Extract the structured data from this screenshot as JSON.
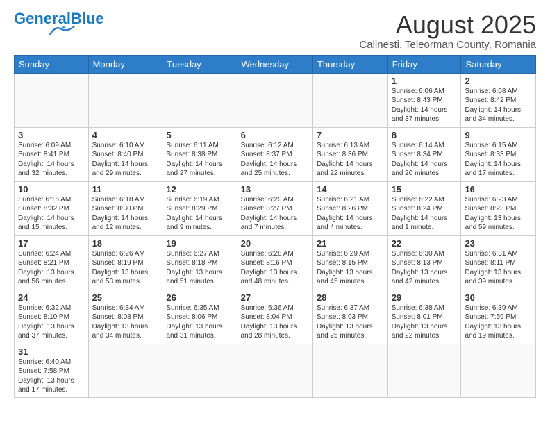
{
  "header": {
    "logo_text_general": "General",
    "logo_text_blue": "Blue",
    "title": "August 2025",
    "subtitle": "Calinesti, Teleorman County, Romania"
  },
  "weekdays": [
    "Sunday",
    "Monday",
    "Tuesday",
    "Wednesday",
    "Thursday",
    "Friday",
    "Saturday"
  ],
  "weeks": [
    [
      {
        "day": "",
        "info": ""
      },
      {
        "day": "",
        "info": ""
      },
      {
        "day": "",
        "info": ""
      },
      {
        "day": "",
        "info": ""
      },
      {
        "day": "",
        "info": ""
      },
      {
        "day": "1",
        "info": "Sunrise: 6:06 AM\nSunset: 8:43 PM\nDaylight: 14 hours and 37 minutes."
      },
      {
        "day": "2",
        "info": "Sunrise: 6:08 AM\nSunset: 8:42 PM\nDaylight: 14 hours and 34 minutes."
      }
    ],
    [
      {
        "day": "3",
        "info": "Sunrise: 6:09 AM\nSunset: 8:41 PM\nDaylight: 14 hours and 32 minutes."
      },
      {
        "day": "4",
        "info": "Sunrise: 6:10 AM\nSunset: 8:40 PM\nDaylight: 14 hours and 29 minutes."
      },
      {
        "day": "5",
        "info": "Sunrise: 6:11 AM\nSunset: 8:38 PM\nDaylight: 14 hours and 27 minutes."
      },
      {
        "day": "6",
        "info": "Sunrise: 6:12 AM\nSunset: 8:37 PM\nDaylight: 14 hours and 25 minutes."
      },
      {
        "day": "7",
        "info": "Sunrise: 6:13 AM\nSunset: 8:36 PM\nDaylight: 14 hours and 22 minutes."
      },
      {
        "day": "8",
        "info": "Sunrise: 6:14 AM\nSunset: 8:34 PM\nDaylight: 14 hours and 20 minutes."
      },
      {
        "day": "9",
        "info": "Sunrise: 6:15 AM\nSunset: 8:33 PM\nDaylight: 14 hours and 17 minutes."
      }
    ],
    [
      {
        "day": "10",
        "info": "Sunrise: 6:16 AM\nSunset: 8:32 PM\nDaylight: 14 hours and 15 minutes."
      },
      {
        "day": "11",
        "info": "Sunrise: 6:18 AM\nSunset: 8:30 PM\nDaylight: 14 hours and 12 minutes."
      },
      {
        "day": "12",
        "info": "Sunrise: 6:19 AM\nSunset: 8:29 PM\nDaylight: 14 hours and 9 minutes."
      },
      {
        "day": "13",
        "info": "Sunrise: 6:20 AM\nSunset: 8:27 PM\nDaylight: 14 hours and 7 minutes."
      },
      {
        "day": "14",
        "info": "Sunrise: 6:21 AM\nSunset: 8:26 PM\nDaylight: 14 hours and 4 minutes."
      },
      {
        "day": "15",
        "info": "Sunrise: 6:22 AM\nSunset: 8:24 PM\nDaylight: 14 hours and 1 minute."
      },
      {
        "day": "16",
        "info": "Sunrise: 6:23 AM\nSunset: 8:23 PM\nDaylight: 13 hours and 59 minutes."
      }
    ],
    [
      {
        "day": "17",
        "info": "Sunrise: 6:24 AM\nSunset: 8:21 PM\nDaylight: 13 hours and 56 minutes."
      },
      {
        "day": "18",
        "info": "Sunrise: 6:26 AM\nSunset: 8:19 PM\nDaylight: 13 hours and 53 minutes."
      },
      {
        "day": "19",
        "info": "Sunrise: 6:27 AM\nSunset: 8:18 PM\nDaylight: 13 hours and 51 minutes."
      },
      {
        "day": "20",
        "info": "Sunrise: 6:28 AM\nSunset: 8:16 PM\nDaylight: 13 hours and 48 minutes."
      },
      {
        "day": "21",
        "info": "Sunrise: 6:29 AM\nSunset: 8:15 PM\nDaylight: 13 hours and 45 minutes."
      },
      {
        "day": "22",
        "info": "Sunrise: 6:30 AM\nSunset: 8:13 PM\nDaylight: 13 hours and 42 minutes."
      },
      {
        "day": "23",
        "info": "Sunrise: 6:31 AM\nSunset: 8:11 PM\nDaylight: 13 hours and 39 minutes."
      }
    ],
    [
      {
        "day": "24",
        "info": "Sunrise: 6:32 AM\nSunset: 8:10 PM\nDaylight: 13 hours and 37 minutes."
      },
      {
        "day": "25",
        "info": "Sunrise: 6:34 AM\nSunset: 8:08 PM\nDaylight: 13 hours and 34 minutes."
      },
      {
        "day": "26",
        "info": "Sunrise: 6:35 AM\nSunset: 8:06 PM\nDaylight: 13 hours and 31 minutes."
      },
      {
        "day": "27",
        "info": "Sunrise: 6:36 AM\nSunset: 8:04 PM\nDaylight: 13 hours and 28 minutes."
      },
      {
        "day": "28",
        "info": "Sunrise: 6:37 AM\nSunset: 8:03 PM\nDaylight: 13 hours and 25 minutes."
      },
      {
        "day": "29",
        "info": "Sunrise: 6:38 AM\nSunset: 8:01 PM\nDaylight: 13 hours and 22 minutes."
      },
      {
        "day": "30",
        "info": "Sunrise: 6:39 AM\nSunset: 7:59 PM\nDaylight: 13 hours and 19 minutes."
      }
    ],
    [
      {
        "day": "31",
        "info": "Sunrise: 6:40 AM\nSunset: 7:58 PM\nDaylight: 13 hours and 17 minutes."
      },
      {
        "day": "",
        "info": ""
      },
      {
        "day": "",
        "info": ""
      },
      {
        "day": "",
        "info": ""
      },
      {
        "day": "",
        "info": ""
      },
      {
        "day": "",
        "info": ""
      },
      {
        "day": "",
        "info": ""
      }
    ]
  ]
}
